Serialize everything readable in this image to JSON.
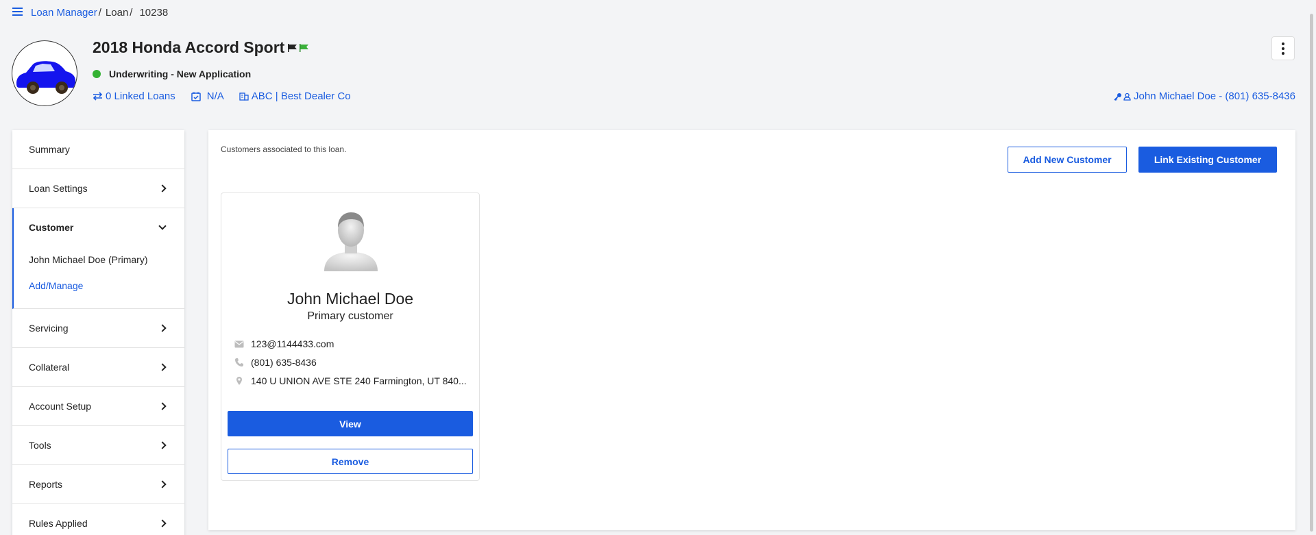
{
  "breadcrumb": {
    "root": "Loan Manager",
    "level2": "Loan",
    "current": "10238"
  },
  "header": {
    "title": "2018 Honda Accord Sport",
    "status": "Underwriting - New Application",
    "status_color": "#34b233",
    "linked_loans": "0 Linked Loans",
    "date": "N/A",
    "dealer": "ABC | Best Dealer Co",
    "owner": "John Michael Doe - (801) 635-8436"
  },
  "sidebar": {
    "items": [
      {
        "label": "Summary"
      },
      {
        "label": "Loan Settings"
      },
      {
        "label": "Customer"
      },
      {
        "label": "Servicing"
      },
      {
        "label": "Collateral"
      },
      {
        "label": "Account Setup"
      },
      {
        "label": "Tools"
      },
      {
        "label": "Reports"
      },
      {
        "label": "Rules Applied"
      }
    ],
    "customer_sub": {
      "primary": "John Michael Doe (Primary)",
      "manage": "Add/Manage"
    }
  },
  "main": {
    "note": "Customers associated to this loan.",
    "add_new_label": "Add New Customer",
    "link_existing_label": "Link Existing Customer"
  },
  "customer_card": {
    "name": "John Michael Doe",
    "role": "Primary customer",
    "email": "123@1144433.com",
    "phone": "(801) 635-8436",
    "address": "140 U UNION AVE STE 240 Farmington, UT 840...",
    "view_label": "View",
    "remove_label": "Remove"
  },
  "colors": {
    "accent": "#1a5ce0",
    "background": "#f3f4f6"
  }
}
